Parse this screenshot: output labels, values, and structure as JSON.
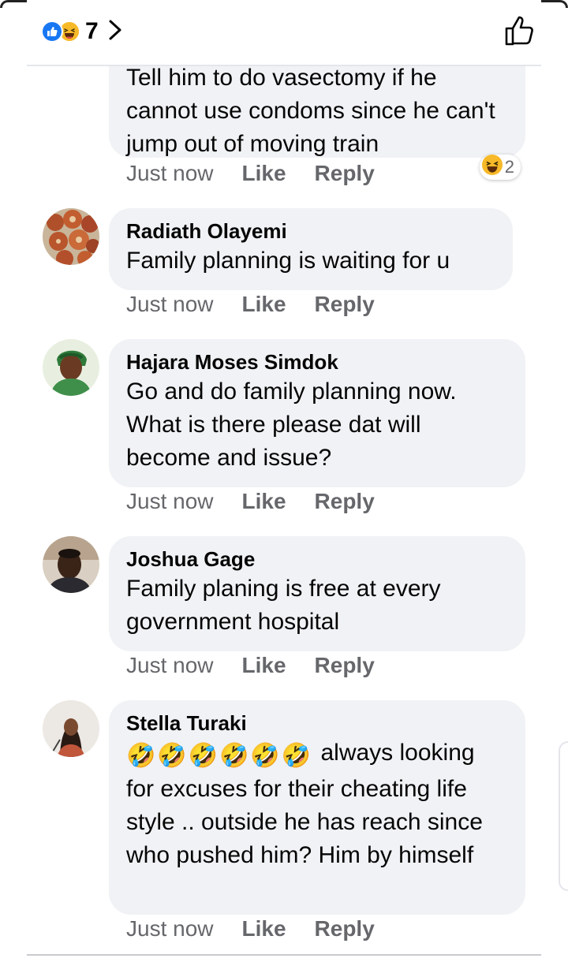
{
  "header": {
    "reaction_count": "7",
    "reaction_icons": [
      "like-icon",
      "haha-icon"
    ]
  },
  "comments": [
    {
      "author": "",
      "text": "Tell him to do vasectomy if he cannot use condoms since he can't jump out of moving train",
      "time": "Just now",
      "like_label": "Like",
      "reply_label": "Reply",
      "reaction": {
        "icon": "haha-icon",
        "count": "2"
      }
    },
    {
      "author": "Radiath Olayemi",
      "text": "Family planning is waiting for u",
      "time": "Just now",
      "like_label": "Like",
      "reply_label": "Reply"
    },
    {
      "author": "Hajara Moses Simdok",
      "text": "Go and do family planning now. What is there please dat will become and issue?",
      "time": "Just now",
      "like_label": "Like",
      "reply_label": "Reply"
    },
    {
      "author": "Joshua Gage",
      "text": "Family planing is free at every government hospital",
      "time": "Just now",
      "like_label": "Like",
      "reply_label": "Reply"
    },
    {
      "author": "Stella Turaki",
      "emoji_prefix": "🤣🤣🤣🤣🤣🤣",
      "text": "always looking for excuses for their cheating life style .. outside he has reach since who pushed him? Him by himself",
      "time": "Just now",
      "like_label": "Like",
      "reply_label": "Reply"
    }
  ],
  "colors": {
    "meta_text": "#65676b",
    "bubble_bg": "#f0f2f5",
    "like_blue": "#1877f2",
    "haha_yellow": "#f7b928"
  }
}
